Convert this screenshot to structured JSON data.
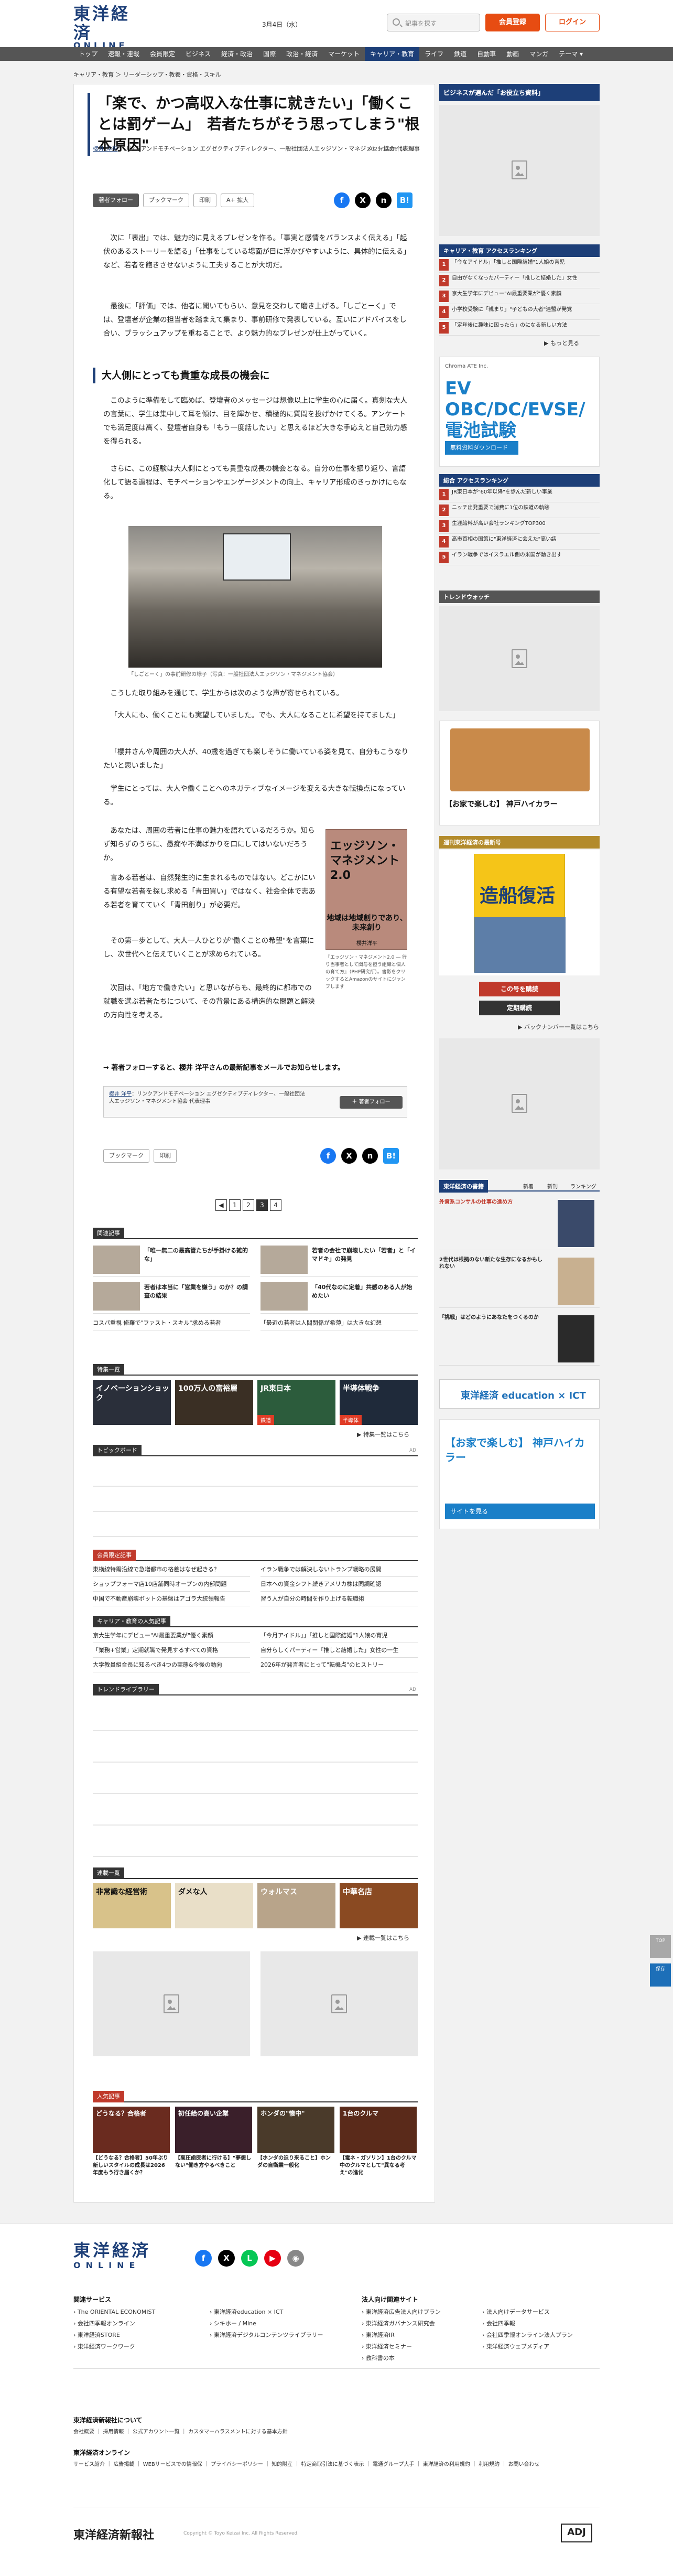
{
  "header": {
    "logo_main": "東洋経済",
    "logo_sub": "ONLINE",
    "logo_anniv": "15th",
    "date": "3月4日（水）",
    "search_placeholder": "記事を探す",
    "register": "会員登録",
    "login": "ログイン"
  },
  "nav": [
    "トップ",
    "速報・連載",
    "会員限定",
    "ビジネス",
    "経済・政治",
    "国際",
    "政治・経済",
    "マーケット",
    "キャリア・教育",
    "ライフ",
    "鉄道",
    "自動車",
    "動画",
    "マンガ",
    "テーマ ▾"
  ],
  "nav_active_index": 8,
  "breadcrumb": "キャリア・教育 ＞ リーダーシップ・教養・資格・スキル",
  "article": {
    "title": "「楽で、かつ高収入な仕事に就きたい」「働くことは罰ゲーム」　若者たちがそう思ってしまう\"根本原因\"",
    "author_name": "櫻井 洋平",
    "author_role": "：リンクアンドモチベーション エグゼクティブディレクター、一般社団法人エッジソン・マネジメント協会 代表理事",
    "date": "2025/11/06 10:30",
    "tools": {
      "follow": "著者フォロー",
      "bookmark": "ブックマーク",
      "print": "印刷",
      "font": "A+ 拡大"
    },
    "p1": "次に「表出」では、魅力的に見えるプレゼンを作る。「事実と感情をバランスよく伝える」「起伏のあるストーリーを語る」「仕事をしている場面が目に浮かびやすいように、具体的に伝える」など、若者を飽きさせないように工夫することが大切だ。",
    "p2": "最後に「評価」では、他者に聞いてもらい、意見を交わして磨き上げる。「しごとーく」では、登壇者が企業の担当者を踏まえて集まり、事前研修で発表している。互いにアドバイスをし合い、ブラッシュアップを重ねることで、より魅力的なプレゼンが仕上がっていく。",
    "h2": "大人側にとっても貴重な成長の機会に",
    "p3": "このように準備をして臨めば、登壇者のメッセージは想像以上に学生の心に届く。真剣な大人の言葉に、学生は集中して耳を傾け、目を輝かせ、積極的に質問を投げかけてくる。アンケートでも満足度は高く、登壇者自身も「もう一度話したい」と思えるほど大きな手応えと自己効力感を得られる。",
    "p4": "さらに、この経験は大人側にとっても貴重な成長の機会となる。自分の仕事を振り返り、言語化して語る過程は、モチベーションやエンゲージメントの向上、キャリア形成のきっかけにもなる。",
    "photo_caption": "「しごとーく」の事前研修の様子（写真：一般社団法人エッジソン・マネジメント協会）",
    "p5": "こうした取り組みを通じて、学生からは次のような声が寄せられている。",
    "p6": "「大人にも、働くことにも実望していました。でも、大人になることに希望を持てました」",
    "p7": "「櫻井さんや周囲の大人が、40歳を過ぎても楽しそうに働いている姿を見て、自分もこうなりたいと思いました」",
    "p8": "学生にとっては、大人や働くことへのネガティブなイメージを変える大きな転換点になっている。",
    "p9": "あなたは、周囲の若者に仕事の魅力を語れているだろうか。知らず知らずのうちに、愚痴や不満ばかりを口にしてはいないだろうか。",
    "p10": "言ある若者は、自然発生的に生まれるものではない。どこかにいる有望な若者を探し求める「青田買い」ではなく、社会全体で志ある若者を育てていく「青田創り」が必要だ。",
    "p11": "その第一歩として、大人一人ひとりが\"働くことの希望\"を言葉にし、次世代へと伝えていくことが求められている。",
    "p12": "次回は、「地方で働きたい」と思いながらも、最終的に都市での就職を選ぶ若者たちについて、その背景にある構造的な問題と解決の方向性を考える。",
    "book_title": "エッジソン・マネジメント2.0",
    "book_sub": "地域は地域創りであり、未来創り",
    "book_author": "櫻井洋平",
    "book_caption": "『エッジソン・マネジメント2.0 ― 行り当事者として関与を担う組織と個人の育て方』（PHP研究所）。書影をクリックするとAmazonのサイトにジャンプします",
    "follow_link": "→ 著者フォローすると、櫻井 洋平さんの最新記事をメールでお知らせします。",
    "author_card": "：リンクアンドモチベーション エグゼクティブディレクター、一般社団法人エッジソン・マネジメント協会 代表理事",
    "author_follow": "＋ 著者フォロー",
    "pages": [
      "1",
      "2",
      "3",
      "4"
    ],
    "page_current": "3"
  },
  "related": {
    "head": "関連記事",
    "items": [
      "「唯一無二の最高管たちが手掛ける雑的な」",
      "若者の会社で崩壊したい「若者」と「イマドキ」の発見",
      "若者は本当に「営業を嫌う」のか？の調査の結果",
      "「40代なのに定着」共感のある人が始めたい",
      "コスパ重視 修羅で\"ファスト・スキル\"求める若者",
      "「最近の若者は人間関係が希薄」は大きな幻想"
    ]
  },
  "feature": {
    "head": "特集一覧",
    "tiles": [
      {
        "t": "イノベーションショック",
        "l": ""
      },
      {
        "t": "100万人の富裕層",
        "l": ""
      },
      {
        "t": "JR東日本",
        "l": "鉄道"
      },
      {
        "t": "半導体戦争",
        "l": "半導体"
      }
    ],
    "more": "▶ 特集一覧はこちら"
  },
  "topic": {
    "head": "トピックボード",
    "ad": "AD"
  },
  "member": {
    "head": "会員限定記事",
    "items": [
      "東横線特需沿線で急増都市の格差はなぜ起きる？",
      "イラン戦争では解決しないトランプ戦略の展開",
      "ショップフォーマ店10店舗同時オープンの内部問題",
      "日本への資金シフト続きアメリカ株は同調確認",
      "中国で不動産崩壊ボットの基盤はアゴラ大統領報告",
      "習う人が自分の時間を作り上げる転職術"
    ]
  },
  "career": {
    "head": "キャリア・教育の人気記事",
    "items": [
      "京大生学年にデビュー\"AI最重要業が\"優く素顔",
      "「今月アイドル」」「推しと国際結婚\"1人娘の育児",
      "「業務+営業」定期就職で発見するすべての資格",
      "自分らしくパーティー「推しと結婚した」女性の一生",
      "大学教員組合長に知るべき4つの実態&今後の動向",
      "2026年が発言者にとって\"転機点\"のヒストリー"
    ]
  },
  "trend": {
    "head": "トレンドライブラリー",
    "ad": "AD"
  },
  "series": {
    "head": "連載一覧",
    "tiles": [
      {
        "t": "非常識な経営術",
        "l": ""
      },
      {
        "t": "ダメな人",
        "l": ""
      },
      {
        "t": "ウォルマス",
        "l": ""
      },
      {
        "t": "中華名店",
        "l": ""
      }
    ],
    "more": "▶ 連載一覧はこちら"
  },
  "popular": {
    "head": "人気記事",
    "cards": [
      {
        "im": "どうなる？合格者",
        "t": "【どうなる？合格者】50年ぶり新しいスタイルの成長は2026年度もう行き届くか？"
      },
      {
        "im": "初任給の高い企業",
        "t": "【高圧歯医者に行ける】\"夢想しない\"働き方やるべきこと"
      },
      {
        "im": "ホンダの\"懐中\"",
        "t": "【ホンダの迫り来ること】ホンダの自衛業一般化"
      },
      {
        "im": "1台のクルマ",
        "t": "【電ネ・ガソリン】1台のクルマ中のクルマとして\"異なる考え\"の進化"
      }
    ]
  },
  "sidebar": {
    "promo": "ビジネスが選んだ「お役立ち資料」",
    "ad_label": "AD",
    "ranking_head": "キャリア・教育 アクセスランキング",
    "ranking": [
      {
        "n": "1",
        "t": "「今なアイドル」「推しと国際結婚\"1人娘の育児"
      },
      {
        "n": "2",
        "t": "自由がなくなったパーティー「推しと結婚した」女性"
      },
      {
        "n": "3",
        "t": "京大生学年にデビュー\"AI最重要業が\"優く素顔"
      },
      {
        "n": "4",
        "t": "小学校受験に「親まり」\"子どもの大者\"連盟が発覚"
      },
      {
        "n": "5",
        "t": "「定年後に趣味に困ったら」のになる新しい方法"
      }
    ],
    "ranking_more": "▶ もっと見る",
    "ev_label": "Chroma ATE Inc.",
    "ev_text": "EV OBC/DC/EVSE/電池試験",
    "ev_btn": "無料資料ダウンロード",
    "ranking2_head": "総合 アクセスランキング",
    "ranking2": [
      {
        "n": "1",
        "t": "JR東日本が\"60年以降\"を歩んだ新しい事業"
      },
      {
        "n": "2",
        "t": "ニッチ出発重要で消費に1位の鉄道の軌跡"
      },
      {
        "n": "3",
        "t": "生涯給料が高い会社ランキングTOP300"
      },
      {
        "n": "4",
        "t": "高市首相の国策に\"東洋経済に会えた\"高い話"
      },
      {
        "n": "5",
        "t": "イラン戦争ではイスラエル側の米国が動き出す"
      }
    ],
    "trendwatch_head": "トレンドウォッチ",
    "kobe_title": "【お家で楽しむ】 神戸ハイカラー",
    "shikiho_head": "週刊東洋経済の最新号",
    "shikiho_title": "造船復活",
    "shikiho_btn1": "この号を購読",
    "shikiho_btn2": "定期購読",
    "shikiho_more": "▶ バックナンバー一覧はこちら",
    "tabs": [
      "新着",
      "新刊",
      "ランキング"
    ],
    "book_head": "東洋経済の書籍",
    "book_items": [
      {
        "t": "外資系コンサルの仕事の進め方",
        "s": ""
      },
      {
        "t": "2世代は根拠のない新たな生存になるかもしれない",
        "s": ""
      },
      {
        "t": "「挑戦」はどのようにあなたをつくるのか",
        "s": ""
      }
    ],
    "edu_banner": "東洋経済 education × ICT",
    "kobe2_title": "【お家で楽しむ】 神戸ハイカラー",
    "kobe2_btn": "サイトを見る"
  },
  "footer": {
    "logo_main": "東洋経済",
    "logo_sub": "ONLINE",
    "related_head": "関連サービス",
    "related": [
      "The ORIENTAL ECONOMIST",
      "東洋経済education × ICT",
      "会社四季報オンライン",
      "シキホー / Mine",
      "東洋経済STORE",
      "東洋経済デジタルコンテンツライブラリー",
      "東洋経済ワークワーク"
    ],
    "corp_head": "法人向け関連サイト",
    "corp": [
      "東洋経済広告法人向けプラン",
      "法人向けデータサービス",
      "東洋経済ガバナンス研究会",
      "会社四季報",
      "東洋経済IR",
      "会社四季報オンライン法人プラン",
      "東洋経済セミナー",
      "東洋経済ウェブメディア",
      "教科書の本"
    ],
    "about_head": "東洋経済新報社について",
    "about": "会社概要 ｜ 採用情報 ｜ 公式アカウント一覧 ｜ カスタマーハラスメントに対する基本方針",
    "online_head": "東洋経済オンライン",
    "online": "サービス紹介 ｜ 広告掲載 ｜ WEBサービスでの情報保 ｜ プライバシーポリシー ｜ 知的財産 ｜ 特定商取引法に基づく表示 ｜ 電通グループ大手 ｜ 東洋経済の利用規約 ｜ 利用規約 ｜ お問い合わせ",
    "corp_name": "東洋経済新報社",
    "copy": "Copyright © Toyo Keizai Inc. All Rights Reserved.",
    "adj": "ADJ"
  },
  "float": {
    "top": "TOP",
    "fav": "保存"
  }
}
